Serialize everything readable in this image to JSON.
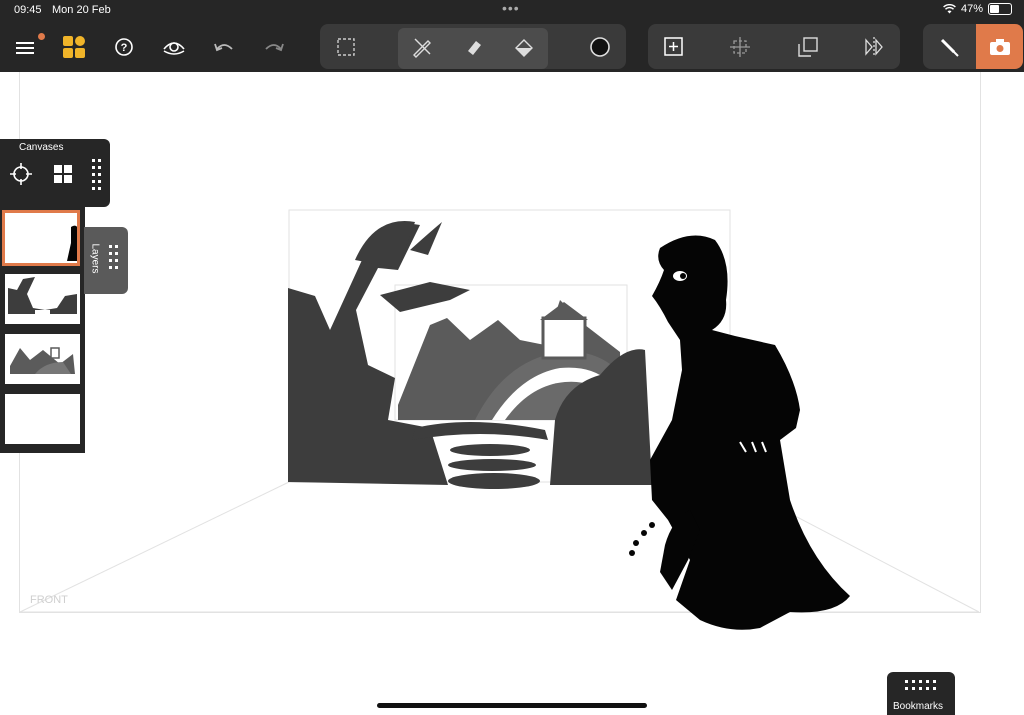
{
  "status": {
    "time": "09:45",
    "date": "Mon 20 Feb",
    "battery": "47%",
    "battery_level": 0.47
  },
  "toolbar": {
    "icons": [
      "menu-icon",
      "projects-icon",
      "help-icon",
      "view-icon",
      "undo-icon",
      "redo-icon",
      "selection-icon",
      "brush-icon",
      "eraser-icon",
      "fill-icon",
      "color-swatch-icon",
      "add-canvas-icon",
      "crop-icon",
      "duplicate-icon",
      "flip-icon",
      "draw-tool-icon",
      "camera-icon"
    ],
    "accent": "#e07a4a"
  },
  "canvases": {
    "title": "Canvases",
    "thumbnail_count": 4,
    "selected_index": 0
  },
  "layers": {
    "label": "Layers"
  },
  "bookmarks": {
    "label": "Bookmarks"
  },
  "canvas": {
    "front_label": "FRONT"
  },
  "colors": {
    "bar": "#262626",
    "panel": "#3a3a3a",
    "active": "#e07a4a",
    "tab": "#5a5a5a"
  }
}
